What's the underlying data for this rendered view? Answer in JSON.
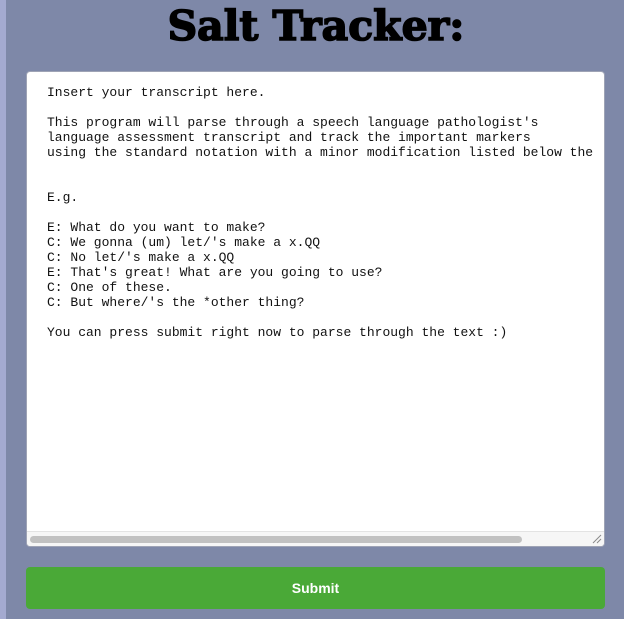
{
  "header": {
    "title": "Salt Tracker:"
  },
  "transcript": {
    "text": "Insert your transcript here.\n\nThis program will parse through a speech language pathologist's\nlanguage assessment transcript and track the important markers\nusing the standard notation with a minor modification listed below the\n\n\nE.g.\n\nE: What do you want to make?\nC: We gonna (um) let/'s make a x.QQ\nC: No let/'s make a x.QQ\nE: That's great! What are you going to use?\nC: One of these.\nC: But where/'s the *other thing?\n\nYou can press submit right now to parse through the text :)"
  },
  "actions": {
    "submit_label": "Submit"
  },
  "icons": {
    "resize": "resize-grip-icon"
  },
  "colors": {
    "background": "#7e88a8",
    "submit": "#4aa937"
  }
}
